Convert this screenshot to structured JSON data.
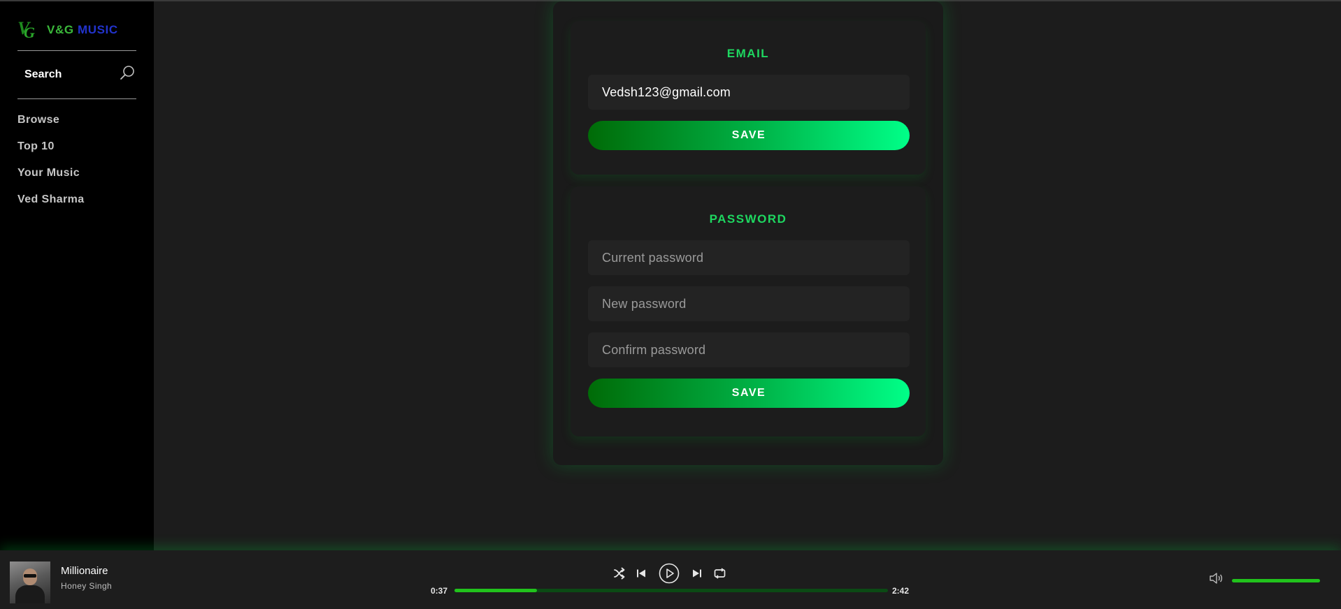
{
  "app": {
    "logo_vg": "V&G",
    "logo_music": "MUSIC",
    "logo_mark": "VG"
  },
  "sidebar": {
    "search_label": "Search",
    "items": [
      {
        "label": "Browse"
      },
      {
        "label": "Top 10"
      },
      {
        "label": "Your Music"
      },
      {
        "label": "Ved Sharma"
      }
    ]
  },
  "settings": {
    "email": {
      "title": "EMAIL",
      "value": "Vedsh123@gmail.com",
      "save_label": "SAVE"
    },
    "password": {
      "title": "PASSWORD",
      "current_placeholder": "Current password",
      "new_placeholder": "New password",
      "confirm_placeholder": "Confirm password",
      "save_label": "SAVE"
    }
  },
  "player": {
    "title": "Millionaire",
    "artist": "Honey Singh",
    "current_time": "0:37",
    "total_time": "2:42",
    "progress_fraction": 0.19,
    "volume_fraction": 1.0,
    "icons": {
      "shuffle": "shuffle-icon",
      "previous": "skip-previous-icon",
      "play": "play-icon",
      "next": "skip-next-icon",
      "repeat": "repeat-icon",
      "volume": "volume-icon"
    }
  },
  "colors": {
    "accent": "#1ed760",
    "progress_fill": "#21c21c",
    "progress_track": "#0b4a14",
    "button_gradient_start": "#006b07",
    "button_gradient_end": "#00ff88",
    "logo_green": "#3bb83b",
    "logo_blue": "#2233cc"
  }
}
